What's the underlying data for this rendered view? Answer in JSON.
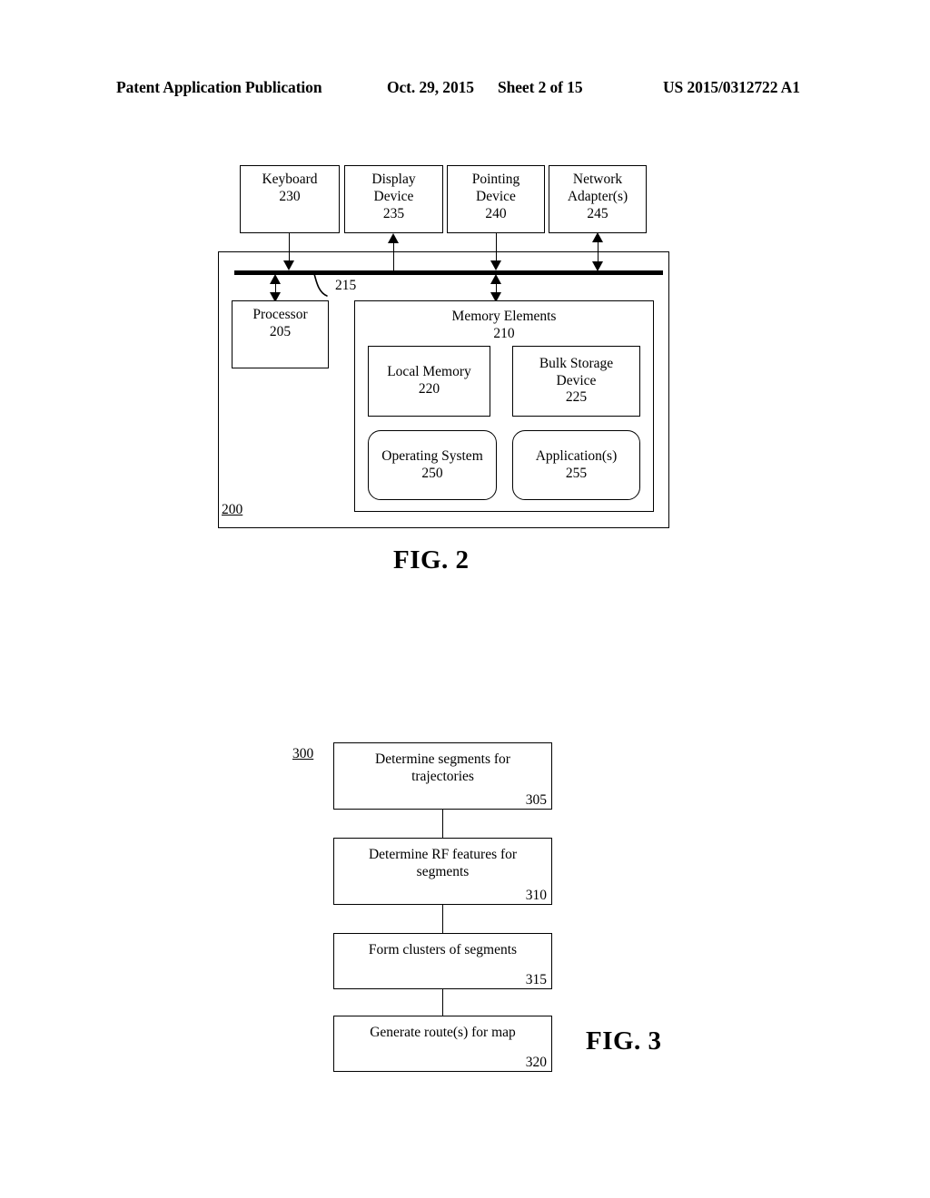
{
  "header": {
    "publication": "Patent Application Publication",
    "date": "Oct. 29, 2015",
    "sheet": "Sheet 2 of 15",
    "doc_number": "US 2015/0312722 A1"
  },
  "figure2": {
    "caption": "FIG. 2",
    "system_ref": "200",
    "bus_ref": "215",
    "peripherals": [
      {
        "name": "keyboard",
        "line1": "Keyboard",
        "line2": "",
        "ref": "230",
        "arrow": "down"
      },
      {
        "name": "display-device",
        "line1": "Display",
        "line2": "Device",
        "ref": "235",
        "arrow": "up"
      },
      {
        "name": "pointing-device",
        "line1": "Pointing",
        "line2": "Device",
        "ref": "240",
        "arrow": "down"
      },
      {
        "name": "network-adapter",
        "line1": "Network",
        "line2": "Adapter(s)",
        "ref": "245",
        "arrow": "both"
      }
    ],
    "processor": {
      "line1": "Processor",
      "ref": "205"
    },
    "memory_elements": {
      "title": "Memory Elements",
      "ref": "210",
      "children": [
        {
          "name": "local-memory",
          "line1": "Local Memory",
          "line2": "",
          "ref": "220",
          "shape": "rect"
        },
        {
          "name": "bulk-storage-device",
          "line1": "Bulk Storage",
          "line2": "Device",
          "ref": "225",
          "shape": "rect"
        },
        {
          "name": "operating-system",
          "line1": "Operating System",
          "line2": "",
          "ref": "250",
          "shape": "rounded"
        },
        {
          "name": "applications",
          "line1": "Application(s)",
          "line2": "",
          "ref": "255",
          "shape": "rounded"
        }
      ]
    }
  },
  "figure3": {
    "caption": "FIG. 3",
    "method_ref": "300",
    "steps": [
      {
        "name": "determine-segments",
        "line1": "Determine segments for",
        "line2": "trajectories",
        "ref": "305"
      },
      {
        "name": "determine-rf",
        "line1": "Determine RF features for",
        "line2": "segments",
        "ref": "310"
      },
      {
        "name": "form-clusters",
        "line1": "Form clusters of segments",
        "line2": "",
        "ref": "315"
      },
      {
        "name": "generate-routes",
        "line1": "Generate route(s) for map",
        "line2": "",
        "ref": "320"
      }
    ]
  },
  "colors": {
    "ink": "#000000",
    "paper": "#ffffff"
  }
}
